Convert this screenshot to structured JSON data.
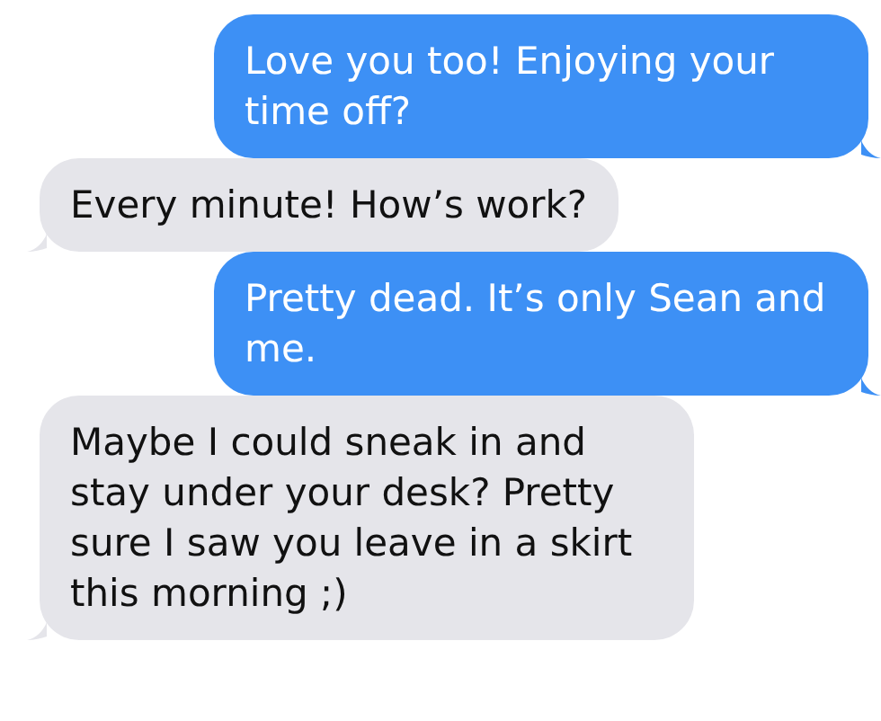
{
  "messages": [
    {
      "kind": "sent",
      "text": "Love you too! Enjoying your time off?"
    },
    {
      "kind": "received",
      "text": "Every minute! How’s work?"
    },
    {
      "kind": "sent",
      "text": "Pretty dead. It’s only Sean and me."
    },
    {
      "kind": "received",
      "text": "Maybe I could sneak in and stay under your desk? Pretty sure I saw you leave in a skirt this morning ;)"
    }
  ]
}
